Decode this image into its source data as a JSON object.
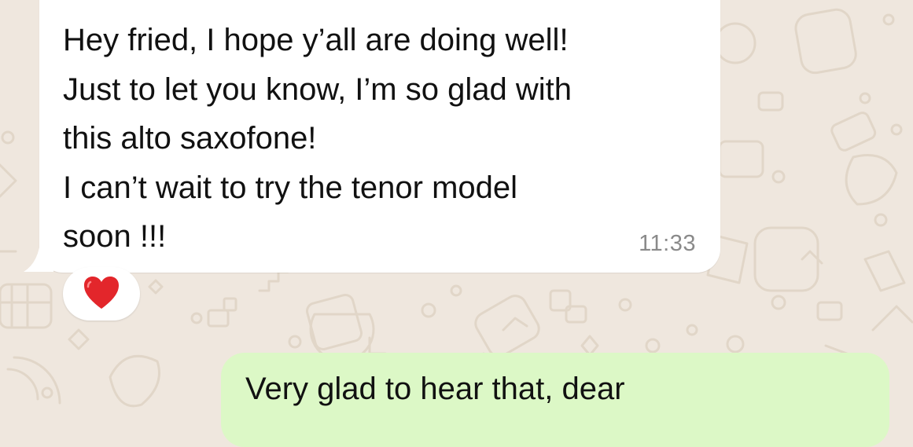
{
  "conversation": {
    "incoming_message": {
      "text": "Hey fried, I hope y’all are doing well!\nJust to let you know, I’m so glad with\nthis alto saxofone!\nI can’t wait to try the tenor model\nsoon !!!",
      "time": "11:33",
      "reaction": "heart-emoji"
    },
    "outgoing_message": {
      "text": "Very glad to hear that, dear"
    }
  },
  "colors": {
    "wallpaper": "#efe7de",
    "wallpaper_doodle": "#e1d6c8",
    "incoming_bubble": "#ffffff",
    "outgoing_bubble": "#dcf8c6",
    "timestamp": "#8a8a8a",
    "heart": "#e3262b"
  }
}
